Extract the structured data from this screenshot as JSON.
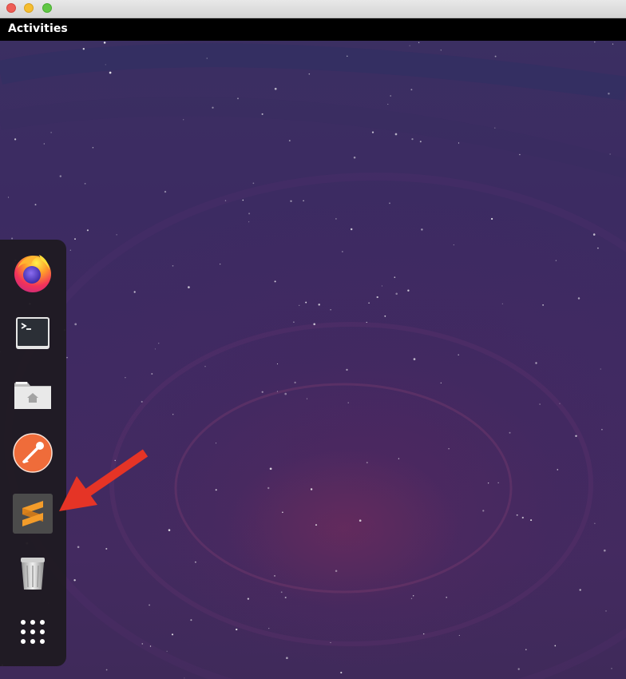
{
  "window": {
    "buttons": [
      "close",
      "minimize",
      "maximize"
    ]
  },
  "topbar": {
    "activities_label": "Activities"
  },
  "dock": {
    "items": [
      {
        "name": "firefox",
        "icon": "firefox-icon"
      },
      {
        "name": "terminal",
        "icon": "terminal-icon"
      },
      {
        "name": "files",
        "icon": "home-folder-icon"
      },
      {
        "name": "postman",
        "icon": "postman-icon"
      },
      {
        "name": "sublime-text",
        "icon": "sublime-text-icon"
      },
      {
        "name": "trash",
        "icon": "trash-icon"
      },
      {
        "name": "show-applications",
        "icon": "app-grid-icon"
      }
    ]
  },
  "annotation": {
    "type": "arrow",
    "color": "#e53426",
    "target": "sublime-text"
  },
  "colors": {
    "topbar": "#000000",
    "wallpaper": "#3f2a62",
    "dock": "#1e1a20",
    "annotation": "#e53426"
  }
}
